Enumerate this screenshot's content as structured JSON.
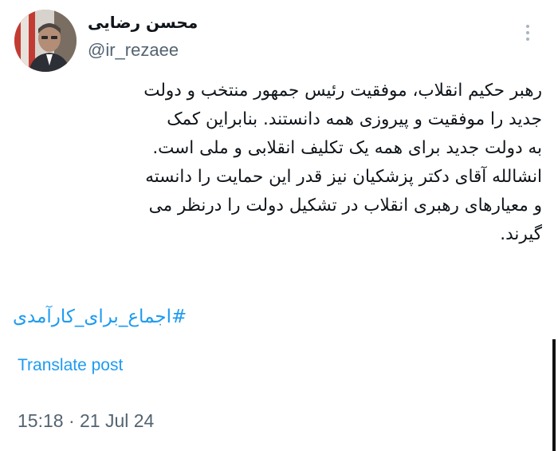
{
  "author": {
    "display_name": "محسن رضایی",
    "handle": "@ir_rezaee"
  },
  "tweet": {
    "lines": [
      "رهبر حکیم انقلاب، موفقیت رئیس جمهور منتخب و دولت",
      "جدید را موفقیت و پیروزی همه دانستند. بنابراین کمک",
      "به دولت جدید برای همه یک تکلیف انقلابی و ملی است.",
      "انشالله آقای دکتر پزشکیان نیز قدر این حمایت را دانسته",
      "و معیارهای رهبری انقلاب در تشکیل دولت را درنظر می",
      "گیرند."
    ],
    "hashtag": "#اجماع_برای_کارآمدی",
    "translate_label": "Translate post",
    "timestamp": "15:18 · 21 Jul 24"
  },
  "icons": {
    "more": "more-vertical-icon"
  },
  "colors": {
    "text": "#0f1419",
    "secondary": "#536471",
    "link": "#1d9bf0",
    "background": "#ffffff"
  }
}
